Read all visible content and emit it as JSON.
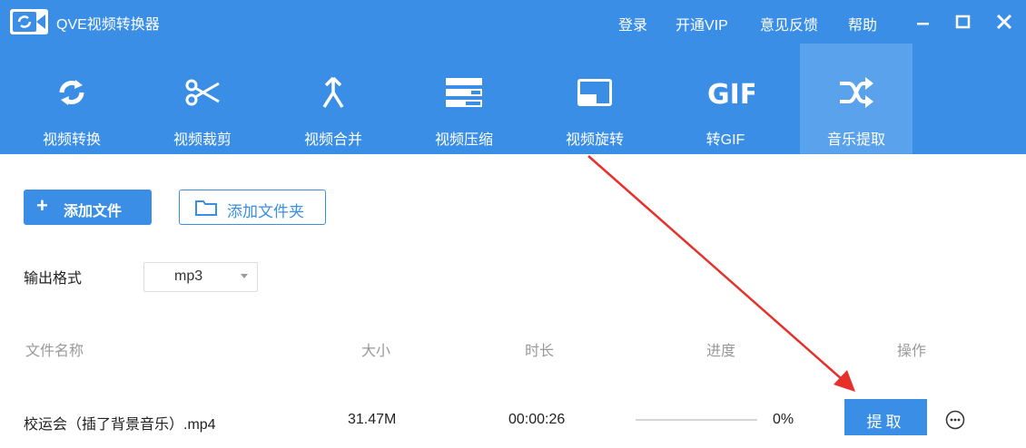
{
  "app": {
    "title": "QVE视频转换器"
  },
  "menu": {
    "login": "登录",
    "vip": "开通VIP",
    "feedback": "意见反馈",
    "help": "帮助"
  },
  "tools": [
    {
      "label": "视频转换",
      "icon": "convert-icon"
    },
    {
      "label": "视频裁剪",
      "icon": "scissors-icon"
    },
    {
      "label": "视频合并",
      "icon": "merge-icon"
    },
    {
      "label": "视频压缩",
      "icon": "compress-icon"
    },
    {
      "label": "视频旋转",
      "icon": "rotate-icon"
    },
    {
      "label": "转GIF",
      "icon": "gif-icon"
    },
    {
      "label": "音乐提取",
      "icon": "shuffle-icon",
      "active": true
    }
  ],
  "actions": {
    "add_file": "添加文件",
    "add_folder": "添加文件夹"
  },
  "output_format": {
    "label": "输出格式",
    "value": "mp3"
  },
  "table": {
    "headers": {
      "name": "文件名称",
      "size": "大小",
      "duration": "时长",
      "progress": "进度",
      "action": "操作"
    },
    "rows": [
      {
        "name": "校运会（插了背景音乐）.mp4",
        "size": "31.47M",
        "duration": "00:00:26",
        "progress_text": "0%",
        "progress": 0,
        "action": "提取"
      }
    ]
  },
  "colors": {
    "accent": "#3a8ee6",
    "active_tab": "#5aa2ec",
    "annotation": "#e8302a"
  }
}
